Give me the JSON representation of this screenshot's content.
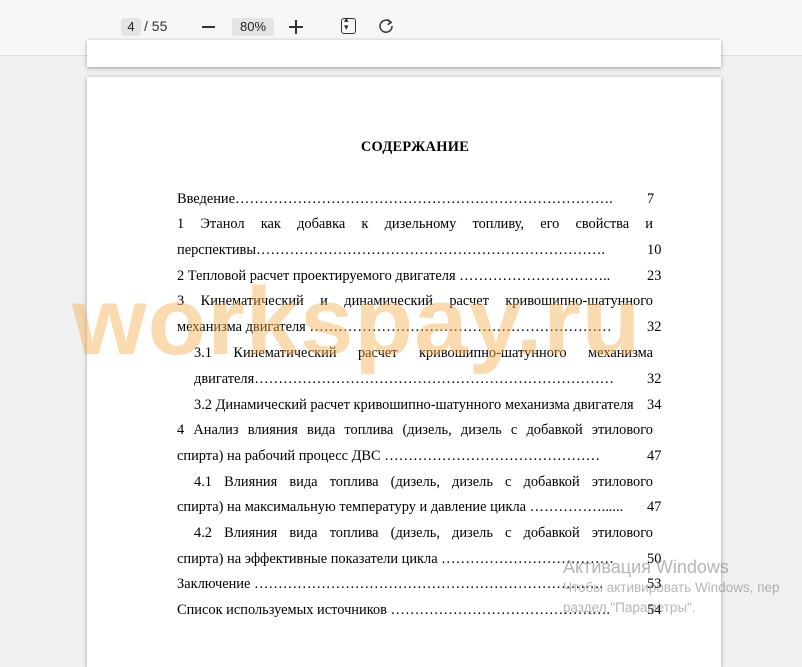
{
  "toolbar": {
    "current_page": "4",
    "total_pages": "/ 55",
    "zoom": "80%",
    "icons": [
      "minus-icon",
      "plus-icon",
      "fit-page-icon",
      "rotate-icon"
    ]
  },
  "document": {
    "title": "СОДЕРЖАНИЕ",
    "entries": [
      {
        "text": "Введение…………………………………………………………………….",
        "page": "7"
      },
      {
        "text": "1 Этанол как добавка к дизельному топливу, его свойства и",
        "page": ""
      },
      {
        "text": "перспективы……………………………………………………………….",
        "page": "10"
      },
      {
        "text": "2 Тепловой расчет проектируемого двигателя …………………………..",
        "page": "23"
      },
      {
        "text": "3 Кинематический и динамический расчет кривошипно-шатунного",
        "page": ""
      },
      {
        "text": "механизма двигателя ………………………………………………………",
        "page": "32"
      },
      {
        "text": "3.1 Кинематический расчет кривошипно-шатунного механизма",
        "page": ""
      },
      {
        "text": "двигателя…………………………………………………………………",
        "page": "32"
      },
      {
        "text": "3.2 Динамический расчет кривошипно-шатунного механизма двигателя",
        "page": "34"
      },
      {
        "text": "4 Анализ влияния вида топлива (дизель, дизель с добавкой этилового",
        "page": ""
      },
      {
        "text": "спирта) на рабочий процесс ДВС ………………………………………",
        "page": "47"
      },
      {
        "text": "4.1 Влияния вида топлива (дизель, дизель с добавкой этилового",
        "page": ""
      },
      {
        "text": "спирта) на максимальную температуру и давление цикла ……………......",
        "page": "47"
      },
      {
        "text": "4.2 Влияния вида топлива (дизель, дизель с добавкой этилового",
        "page": ""
      },
      {
        "text": "спирта) на эффективные показатели цикла ………………………………",
        "page": "50"
      },
      {
        "text": "Заключение ……………………………………………………………….",
        "page": "53"
      },
      {
        "text": "Список используемых источников ……………………………………….",
        "page": "54"
      }
    ]
  },
  "watermark": "workspay.ru",
  "activation": {
    "title": "Активация Windows",
    "line1": "Чтобы активировать Windows, пер",
    "line2": "раздел \"Параметры\"."
  }
}
